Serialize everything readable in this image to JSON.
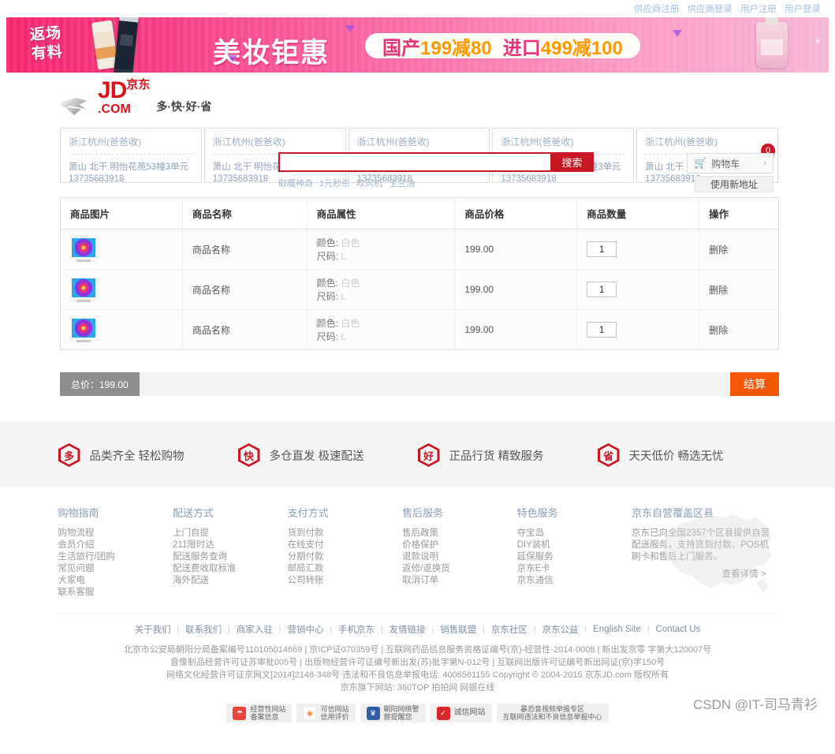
{
  "topbar": {
    "links": [
      {
        "label": "供应商注册"
      },
      {
        "label": "供应商登录"
      },
      {
        "label": "用户注册"
      },
      {
        "label": "用户登录"
      }
    ]
  },
  "banner": {
    "badge": "返场\n有料",
    "badge_line1": "返场",
    "badge_line2": "有料",
    "title": "美妆钜惠",
    "promo_cn1": "国产",
    "promo_num1": "199减80",
    "promo_cn2": "进口",
    "promo_num2": "499减100",
    "close": "×"
  },
  "header": {
    "logo_jd": "JD",
    "logo_cn": "京东",
    "logo_com": ".COM",
    "slogan": "多·快·好·省",
    "search_value": "",
    "search_placeholder": "",
    "search_button": "搜索",
    "hotwords": [
      "取暖神奇",
      "1元秒杀",
      "吹风机",
      "玉兰油"
    ],
    "cart_label": "购物车",
    "cart_count": "0",
    "cart_arrow": "›",
    "cart_icon": "shopping-cart-icon",
    "new_address_button": "使用新地址"
  },
  "addresses": [
    {
      "title": "浙江杭州(爸爸收)",
      "detail": "萧山 北干 明怡花苑53幢3单元",
      "phone": "13735683918"
    },
    {
      "title": "浙江杭州(爸爸收)",
      "detail": "萧山 北干 明怡花苑53幢3单元",
      "phone": "13735683918"
    },
    {
      "title": "浙江杭州(爸爸收)",
      "detail": "萧山 北干 明怡花苑53幢3单元",
      "phone": "13735683918"
    },
    {
      "title": "浙江杭州(爸爸收)",
      "detail": "萧山 北干 明怡花苑53幢3单元",
      "phone": "13735683918"
    },
    {
      "title": "浙江杭州(爸爸收)",
      "detail": "萧山 北干 明怡花苑53幢3单元",
      "phone": "13735683918"
    }
  ],
  "cart": {
    "headers": [
      "商品图片",
      "商品名称",
      "商品属性",
      "商品价格",
      "商品数量",
      "操作"
    ],
    "rows": [
      {
        "name": "商品名称",
        "attr_color_label": "颜色:",
        "attr_color_value": "白色",
        "attr_size_label": "尺码:",
        "attr_size_value": "L",
        "price": "199.00",
        "qty": "1",
        "action": "删除"
      },
      {
        "name": "商品名称",
        "attr_color_label": "颜色:",
        "attr_color_value": "白色",
        "attr_size_label": "尺码:",
        "attr_size_value": "L",
        "price": "199.00",
        "qty": "1",
        "action": "删除"
      },
      {
        "name": "商品名称",
        "attr_color_label": "颜色:",
        "attr_color_value": "白色",
        "attr_size_label": "尺码:",
        "attr_size_value": "L",
        "price": "199.00",
        "qty": "1",
        "action": "删除"
      }
    ],
    "total_label": "总价：199.00",
    "checkout_button": "结算"
  },
  "features": [
    {
      "icon_char": "多",
      "text": "品类齐全 轻松购物"
    },
    {
      "icon_char": "快",
      "text": "多仓直发 极速配送"
    },
    {
      "icon_char": "好",
      "text": "正品行货 精致服务"
    },
    {
      "icon_char": "省",
      "text": "天天低价 畅选无忧"
    }
  ],
  "footer": {
    "columns": [
      {
        "title": "购物指南",
        "items": [
          "购物流程",
          "会员介绍",
          "生活旅行/团购",
          "常见问题",
          "大家电",
          "联系客服"
        ]
      },
      {
        "title": "配送方式",
        "items": [
          "上门自提",
          "211限时达",
          "配送服务查询",
          "配送费收取标准",
          "海外配送"
        ]
      },
      {
        "title": "支付方式",
        "items": [
          "货到付款",
          "在线支付",
          "分期付款",
          "邮局汇款",
          "公司转账"
        ]
      },
      {
        "title": "售后服务",
        "items": [
          "售后政策",
          "价格保护",
          "退款说明",
          "返修/退换货",
          "取消订单"
        ]
      },
      {
        "title": "特色服务",
        "items": [
          "夺宝岛",
          "DIY装机",
          "延保服务",
          "京东E卡",
          "京东通信"
        ]
      }
    ],
    "map": {
      "title": "京东自营覆盖区县",
      "text": "京东已向全国2357个区县提供自营配送服务，支持货到付款、POS机刷卡和售后上门服务。",
      "more": "查看详情 >"
    },
    "links": [
      "关于我们",
      "联系我们",
      "商家入驻",
      "营销中心",
      "手机京东",
      "友情链接",
      "销售联盟",
      "京东社区",
      "京东公益",
      "English Site",
      "Contact Us"
    ],
    "legal_lines": [
      "北京市公安局朝阳分局备案编号110105014669 | 京ICP证070359号 | 互联网药品信息服务资格证编号(京)-经营性-2014-0008 | 新出发京零 字第大120007号",
      "音像制品经营许可证苏审批005号 | 出版物经营许可证编号新出发(苏)批字第N-012号 | 互联网出版许可证编号新出网证(京)字150号",
      "网络文化经营许可证京网文[2014]2148-348号 违法和不良信息举报电话: 4006561155 Copyright © 2004-2015 京东JD.com 版权所有",
      "京东旗下网站: 360TOP 拍拍网 网银在线"
    ],
    "certs": [
      {
        "icon": "shield-icon",
        "color": "#e8453c",
        "line1": "经营性网站",
        "line2": "备案信息"
      },
      {
        "icon": "spiral-icon",
        "color": "#f28c28",
        "line1": "可信网站",
        "line2": "信用评价"
      },
      {
        "icon": "police-icon",
        "color": "#2f5fa8",
        "line1": "朝阳网络警",
        "line2": "察提醒您"
      },
      {
        "icon": "seal-icon",
        "color": "#d9262c",
        "line1": "诚信网站",
        "line2": ""
      },
      {
        "icon": "report-icon",
        "color": "#bbbbbb",
        "line1": "暴恐音视频举报专区",
        "line2": "互联网违法和不良信息举报中心"
      }
    ]
  },
  "watermark": "CSDN @IT-司马青衫"
}
